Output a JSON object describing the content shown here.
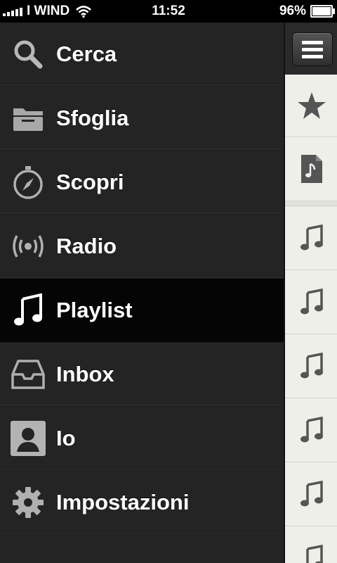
{
  "status": {
    "carrier": "I WIND",
    "time": "11:52",
    "battery": "96%",
    "battery_level": 0.96
  },
  "menu": {
    "items": [
      {
        "label": "Cerca",
        "icon": "search-icon"
      },
      {
        "label": "Sfoglia",
        "icon": "folder-icon"
      },
      {
        "label": "Scopri",
        "icon": "compass-icon"
      },
      {
        "label": "Radio",
        "icon": "radio-icon"
      },
      {
        "label": "Playlist",
        "icon": "music-note-icon",
        "active": true
      },
      {
        "label": "Inbox",
        "icon": "inbox-tray-icon"
      },
      {
        "label": "Io",
        "icon": "user-profile-icon"
      },
      {
        "label": "Impostazioni",
        "icon": "gear-icon"
      }
    ]
  },
  "panel": {
    "icons": [
      "menu-icon",
      "star-icon",
      "music-file-icon",
      "music-note-icon"
    ]
  },
  "colors": {
    "menu_bg": "#242424",
    "menu_active": "#050505",
    "panel_bg": "#efefea"
  }
}
